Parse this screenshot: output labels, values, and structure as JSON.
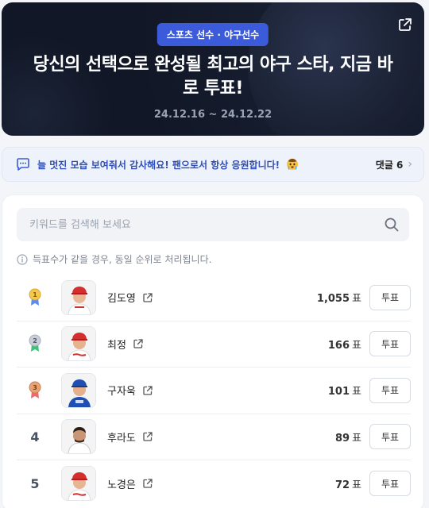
{
  "hero": {
    "badge": "스포츠 선수 · 야구선수",
    "title": "당신의 선택으로 완성될 최고의 야구 스타, 지금 바로 투표!",
    "period": "24.12.16 ~ 24.12.22"
  },
  "comment_bar": {
    "message": "늘 멋진 모습 보여줘서 감사해요! 팬으로서 항상 응원합니다!",
    "count_label": "댓글 6"
  },
  "search": {
    "placeholder": "키워드를 검색해 보세요"
  },
  "notice": "득표수가 같을 경우, 동일 순위로 처리됩니다.",
  "vote_unit": "표",
  "players": [
    {
      "rank": "1",
      "name": "김도영",
      "votes": "1,055",
      "button": "투표",
      "medal_color": "#f2c94c",
      "ribbon_color": "#5b8def",
      "uniform": "#d32f2f"
    },
    {
      "rank": "2",
      "name": "최정",
      "votes": "166",
      "button": "투표",
      "medal_color": "#c9ced8",
      "ribbon_color": "#3fc17a",
      "uniform": "#d32f2f"
    },
    {
      "rank": "3",
      "name": "구자욱",
      "votes": "101",
      "button": "투표",
      "medal_color": "#e8a374",
      "ribbon_color": "#ef6b6b",
      "uniform": "#1f4fb5"
    },
    {
      "rank": "4",
      "name": "후라도",
      "votes": "89",
      "button": "투표",
      "uniform": "#ffffff"
    },
    {
      "rank": "5",
      "name": "노경은",
      "votes": "72",
      "button": "투표",
      "uniform": "#d32f2f"
    }
  ]
}
